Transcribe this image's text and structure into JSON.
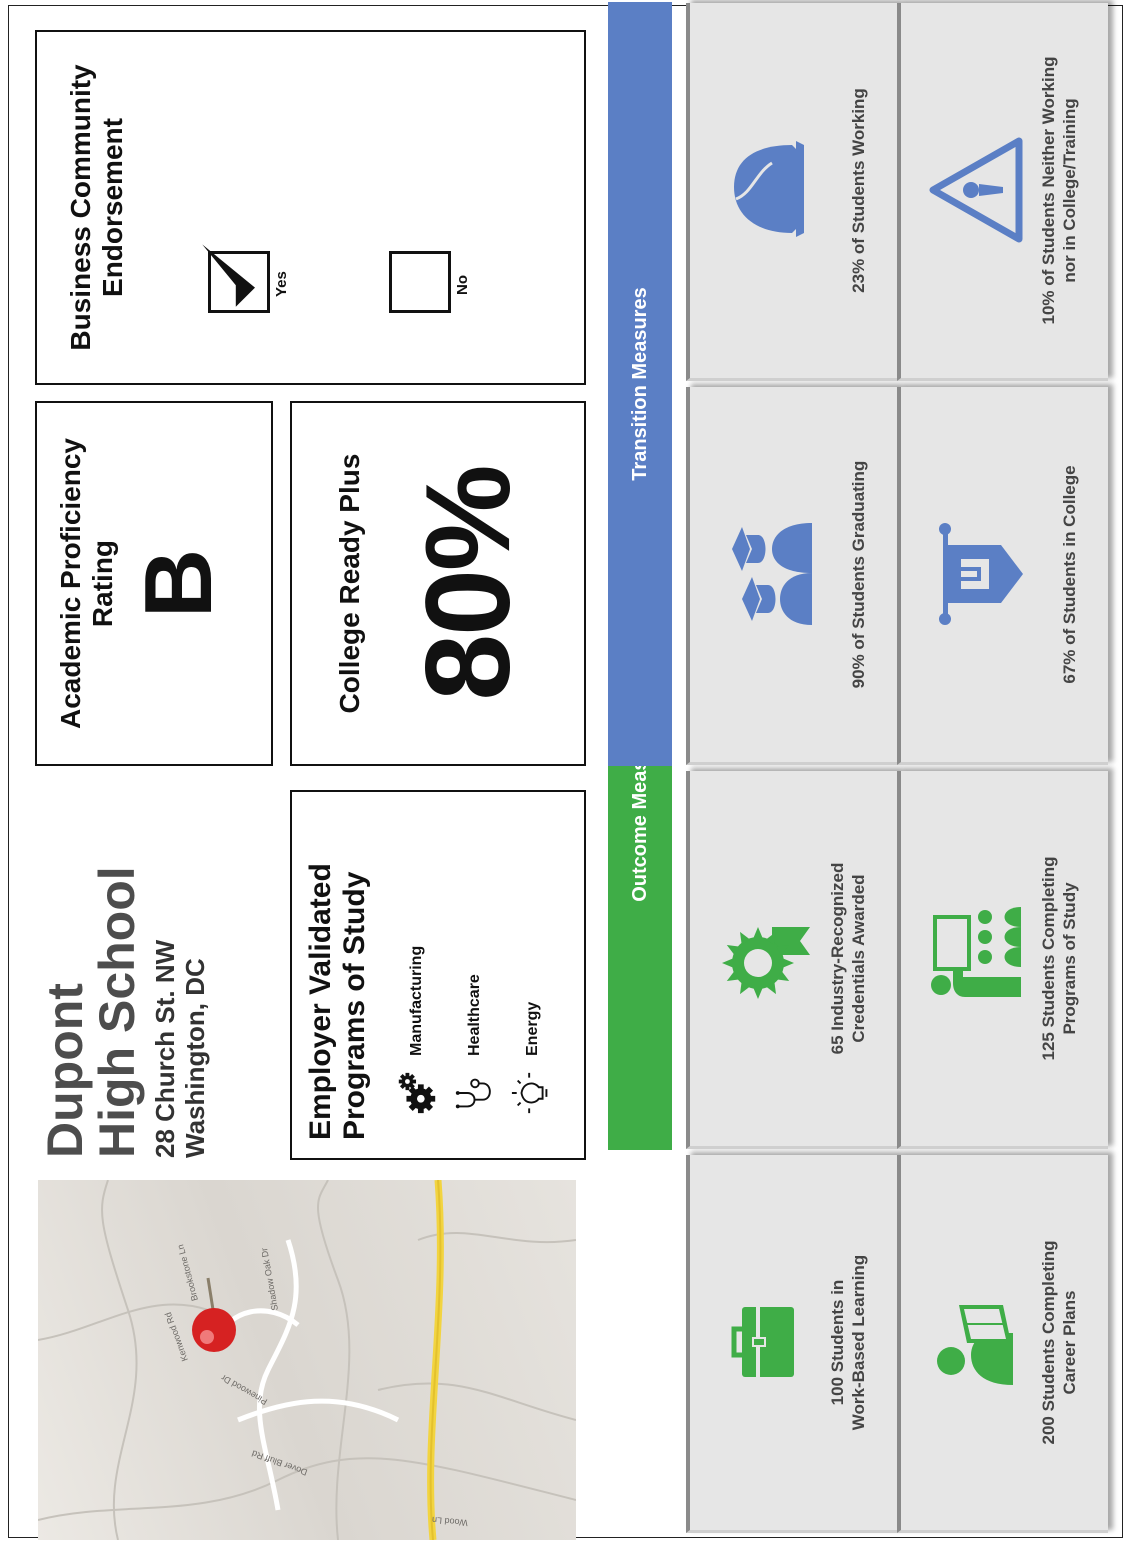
{
  "school": {
    "name_line1": "Dupont",
    "name_line2": "High School",
    "address_line1": "28 Church St. NW",
    "address_line2": "Washington, DC"
  },
  "map": {
    "streets": [
      "Dover Bluff Rd",
      "Pinewood Dr",
      "Brookstone Ln",
      "Shadow Oak Dr",
      "Kenwood Rd",
      "Wood Ln"
    ]
  },
  "programs": {
    "title_line1": "Employer Validated",
    "title_line2": "Programs of Study",
    "items": [
      {
        "label": "Manufacturing",
        "icon": "gears-icon"
      },
      {
        "label": "Healthcare",
        "icon": "stethoscope-icon"
      },
      {
        "label": "Energy",
        "icon": "lightbulb-icon"
      }
    ]
  },
  "academic": {
    "title_line1": "Academic Proficiency",
    "title_line2": "Rating",
    "value": "B"
  },
  "college_ready": {
    "title": "College Ready Plus",
    "value": "80%"
  },
  "endorsement": {
    "title_line1": "Business Community",
    "title_line2": "Endorsement",
    "yes_label": "Yes",
    "no_label": "No",
    "selected": "Yes"
  },
  "outcome": {
    "header": "Outcome Measures",
    "color": "#3fad47",
    "tiles": [
      {
        "line1": "100 Students in",
        "line2": "Work-Based Learning",
        "icon": "briefcase-icon"
      },
      {
        "line1": "200 Students Completing",
        "line2": "Career Plans",
        "icon": "student-reading-icon"
      },
      {
        "line1": "65 Industry-Recognized",
        "line2": "Credentials Awarded",
        "icon": "award-ribbon-icon"
      },
      {
        "line1": "125 Students Completing",
        "line2": "Programs of Study",
        "icon": "classroom-icon"
      }
    ]
  },
  "transition": {
    "header": "Transition Measures",
    "color": "#5b7fc5",
    "tiles": [
      {
        "line1": "90% of Students Graduating",
        "line2": "",
        "icon": "graduates-icon"
      },
      {
        "line1": "67% of Students in College",
        "line2": "",
        "icon": "college-banner-icon"
      },
      {
        "line1": "23% of Students Working",
        "line2": "",
        "icon": "hard-hat-icon"
      },
      {
        "line1": "10% of Students Neither Working",
        "line2": "nor in College/Training",
        "icon": "warning-icon"
      }
    ]
  }
}
